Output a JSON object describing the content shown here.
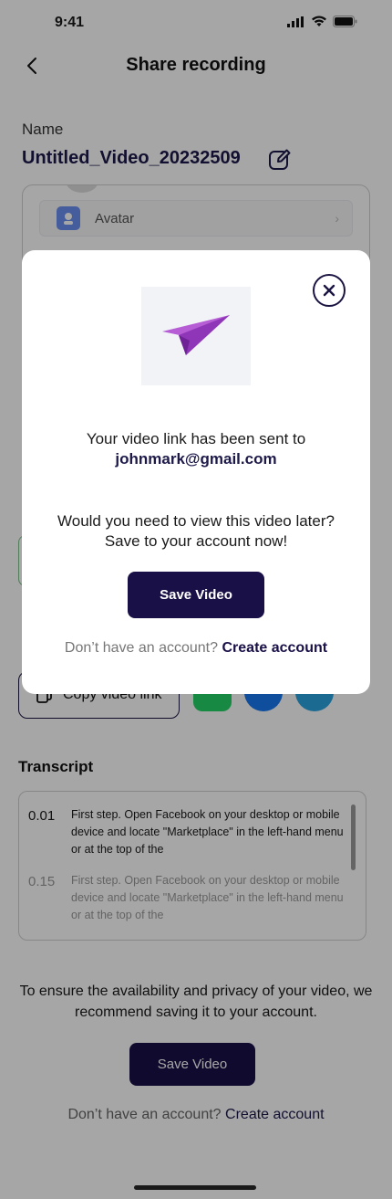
{
  "status": {
    "time": "9:41"
  },
  "header": {
    "title": "Share recording"
  },
  "name_section": {
    "label": "Name",
    "value": "Untitled_Video_20232509"
  },
  "avatar_panel": {
    "row_label": "Avatar"
  },
  "share": {
    "copy_label": "Copy video link",
    "icons": [
      "whatsapp-icon",
      "facebook-icon",
      "telegram-icon"
    ]
  },
  "transcript": {
    "title": "Transcript",
    "rows": [
      {
        "time": "0.01",
        "text": "First step. Open Facebook on your desktop or mobile device and locate \"Marketplace\" in the left-hand menu or at the top of the"
      },
      {
        "time": "0.15",
        "text": "First step. Open Facebook on your desktop or mobile device and locate \"Marketplace\" in the left-hand menu or at the top of the"
      }
    ]
  },
  "bottom": {
    "info": "To ensure the availability and privacy of your video, we recommend saving it to your account.",
    "save_label": "Save Video",
    "no_account": "Don’t have an account?",
    "create_label": "Create account"
  },
  "modal": {
    "sent_text": "Your video link has been sent to",
    "email": "johnmark@gmail.com",
    "question": "Would you need to view this video later? Save to your account now!",
    "save_label": "Save Video",
    "no_account": "Don’t have an account?",
    "create_label": "Create account"
  },
  "colors": {
    "primary": "#1a1048",
    "accent_purple": "#9b3fc8"
  }
}
